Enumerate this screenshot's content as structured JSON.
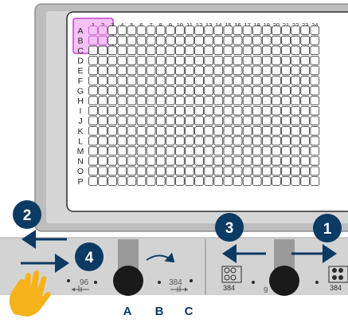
{
  "plate": {
    "columns": [
      "1",
      "2",
      "3",
      "4",
      "5",
      "6",
      "7",
      "8",
      "9",
      "10",
      "11",
      "12",
      "13",
      "14",
      "15",
      "16",
      "17",
      "18",
      "19",
      "20",
      "21",
      "22",
      "23",
      "24"
    ],
    "rows": [
      "A",
      "B",
      "C",
      "D",
      "E",
      "F",
      "G",
      "H",
      "I",
      "J",
      "K",
      "L",
      "M",
      "N",
      "O",
      "P"
    ],
    "highlighted_columns": [
      "1",
      "2"
    ],
    "highlighted_rows": [
      "A",
      "B"
    ],
    "highlight_color": "#c046c8"
  },
  "steps": [
    {
      "number": "1"
    },
    {
      "number": "2"
    },
    {
      "number": "3"
    },
    {
      "number": "4"
    }
  ],
  "positions": [
    "A",
    "B",
    "C"
  ],
  "left_dial": {
    "label_96": "96",
    "label_384": "384"
  },
  "right_dial": {
    "partial_label": "9",
    "label_384_a": "384",
    "label_384_b": "384"
  },
  "colors": {
    "step_badge": "#0b3a63",
    "arrow": "#0b3a63",
    "hand": "#f5b21a",
    "base_gray": "#d3d3d3",
    "slider": "#9a9a9a",
    "knob": "#1a1a1a"
  }
}
